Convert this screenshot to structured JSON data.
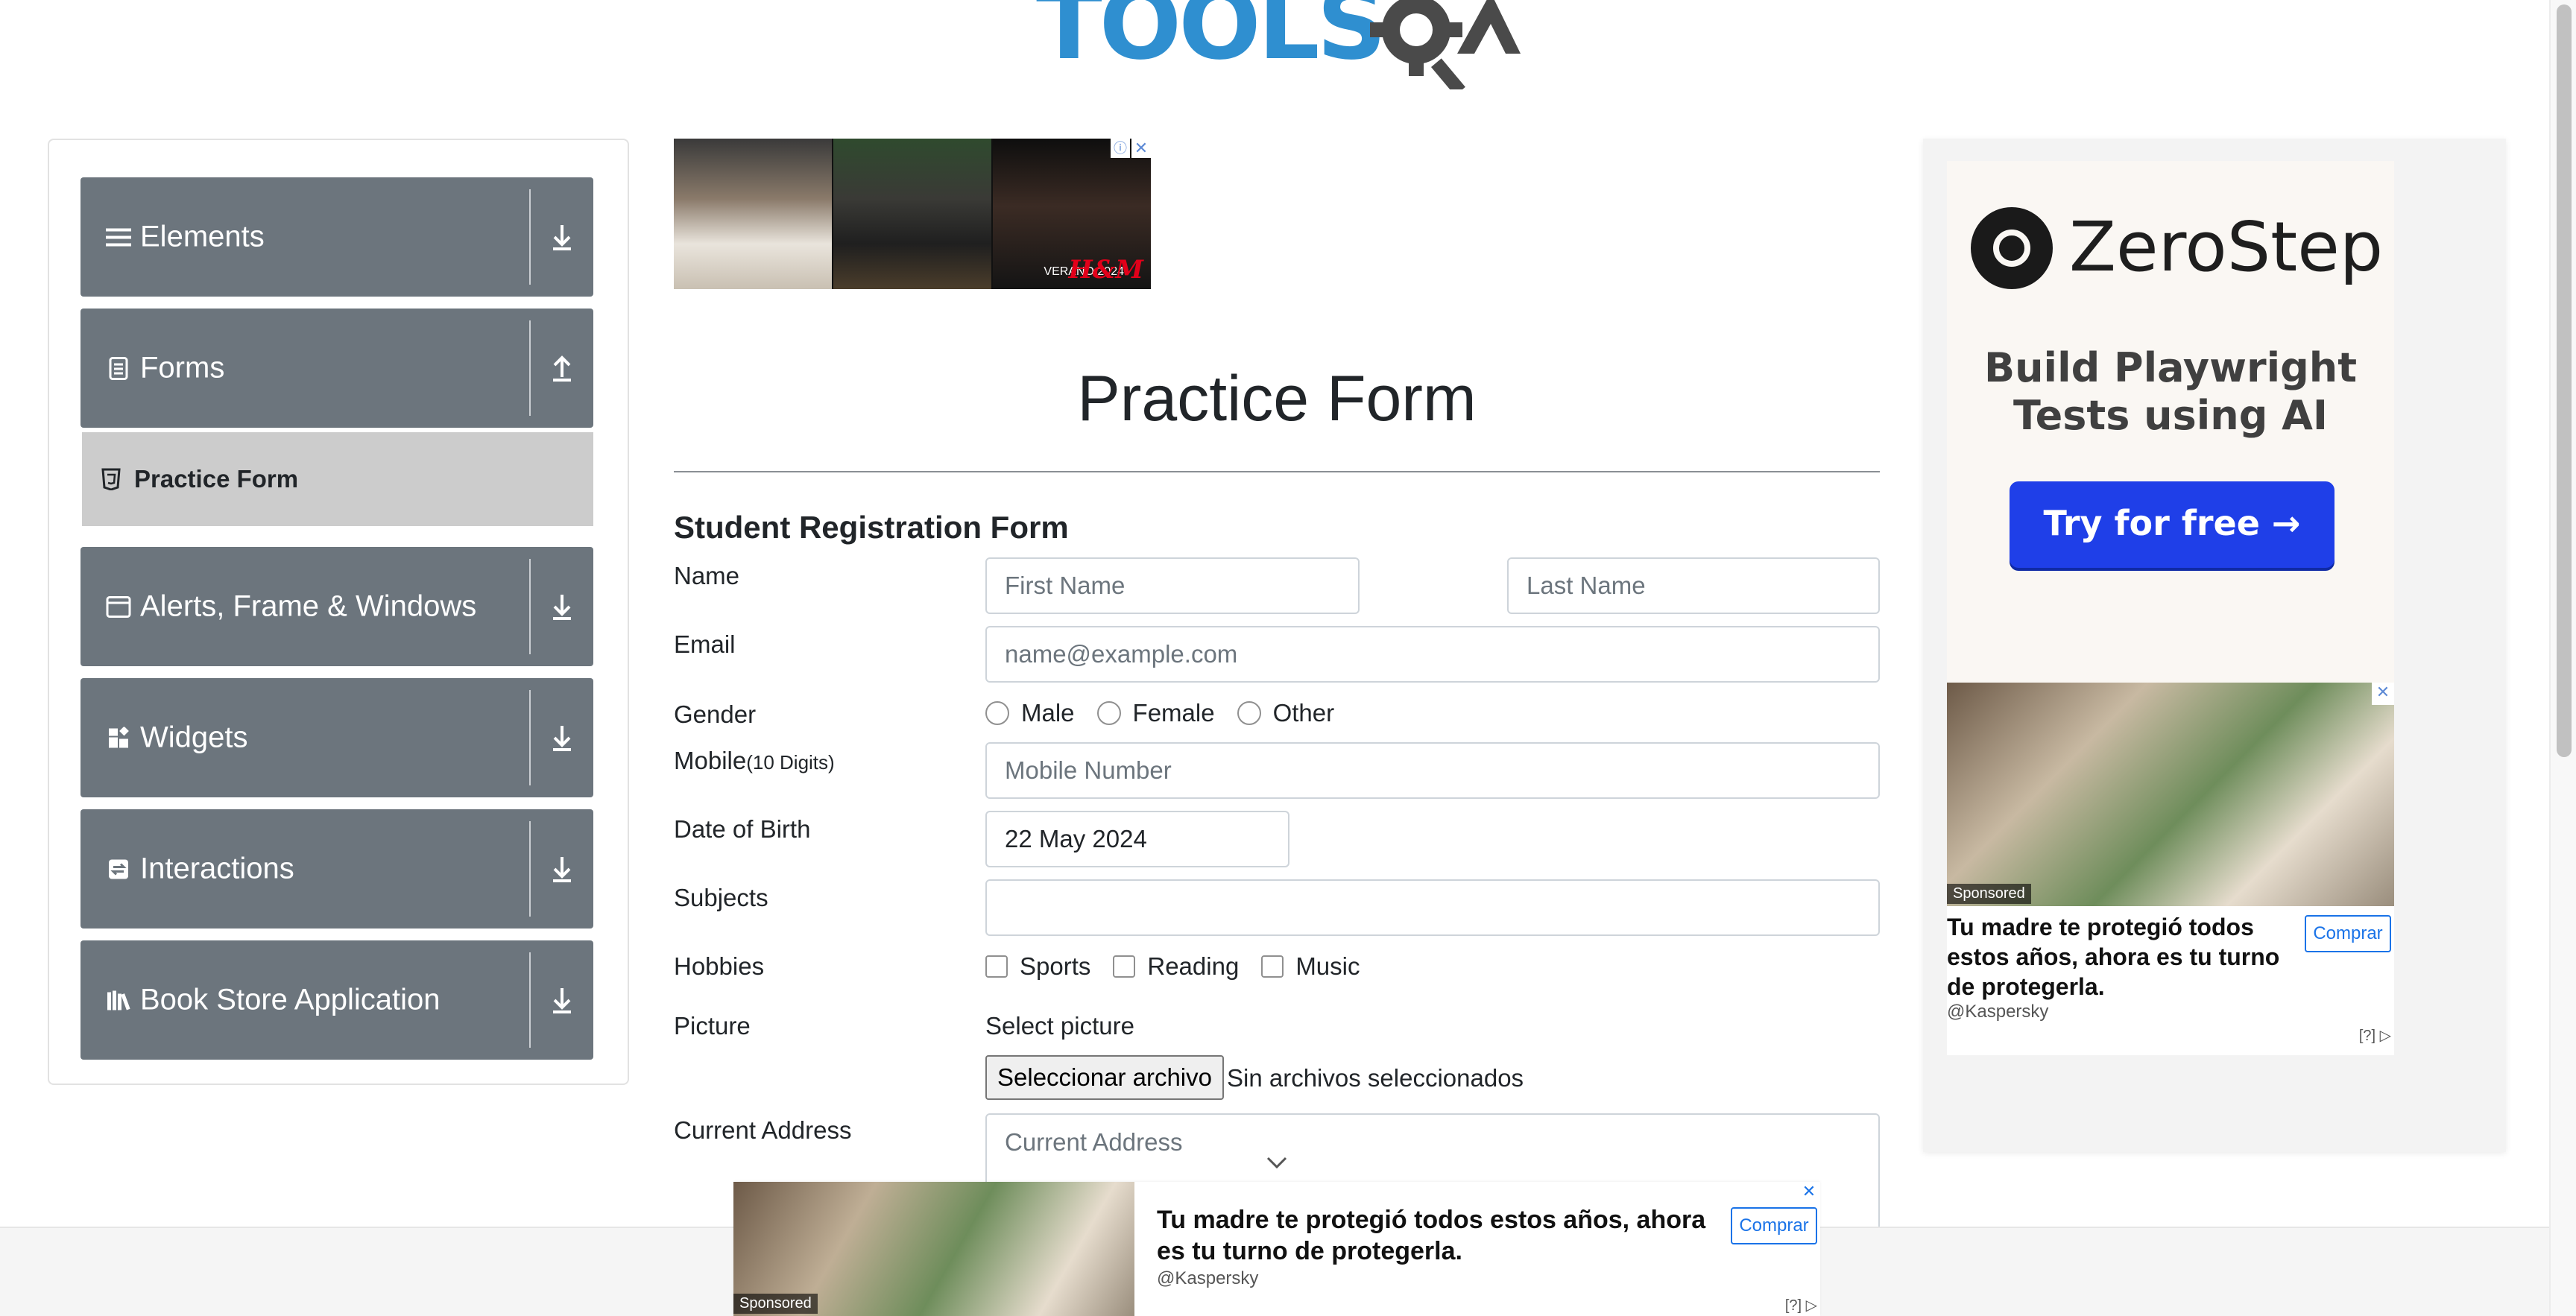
{
  "logo": {
    "text": "TOOLSQA"
  },
  "sidebar": {
    "groups": [
      {
        "label": "Elements",
        "icon": "hamburger-icon",
        "arrow": "download-icon"
      },
      {
        "label": "Forms",
        "icon": "document-icon",
        "arrow": "upload-icon"
      },
      {
        "label": "Alerts, Frame & Windows",
        "icon": "window-icon",
        "arrow": "download-icon"
      },
      {
        "label": "Widgets",
        "icon": "widgets-icon",
        "arrow": "download-icon"
      },
      {
        "label": "Interactions",
        "icon": "interactions-icon",
        "arrow": "download-icon"
      },
      {
        "label": "Book Store Application",
        "icon": "books-icon",
        "arrow": "download-icon"
      }
    ],
    "active_item": {
      "label": "Practice Form",
      "icon": "html5-icon"
    }
  },
  "top_ad": {
    "tag": "VERANO 2024",
    "brand": "H&M"
  },
  "main": {
    "title": "Practice Form",
    "form_title": "Student Registration Form",
    "name": {
      "label": "Name",
      "first_placeholder": "First Name",
      "last_placeholder": "Last Name"
    },
    "email": {
      "label": "Email",
      "placeholder": "name@example.com"
    },
    "gender": {
      "label": "Gender",
      "options": [
        "Male",
        "Female",
        "Other"
      ]
    },
    "mobile": {
      "label": "Mobile",
      "label_suffix": "(10 Digits)",
      "placeholder": "Mobile Number"
    },
    "dob": {
      "label": "Date of Birth",
      "value": "22 May 2024"
    },
    "subjects": {
      "label": "Subjects",
      "value": ""
    },
    "hobbies": {
      "label": "Hobbies",
      "options": [
        "Sports",
        "Reading",
        "Music"
      ]
    },
    "picture": {
      "label": "Picture",
      "select_text": "Select picture",
      "button": "Seleccionar archivo",
      "status": "Sin archivos seleccionados"
    },
    "address": {
      "label": "Current Address",
      "placeholder": "Current Address"
    }
  },
  "right_ad": {
    "brand": "ZeroStep",
    "tagline": "Build Playwright Tests using AI",
    "cta": "Try for free →",
    "sponsored": "Sponsored",
    "text": "Tu madre te protegió todos estos años, ahora es tu turno de protegerla.",
    "handle": "@Kaspersky",
    "buy": "Comprar",
    "q": "[?]"
  },
  "bottom_ad": {
    "sponsored": "Sponsored",
    "text": "Tu madre te protegió todos estos años, ahora es tu turno de protegerla.",
    "handle": "@Kaspersky",
    "buy": "Comprar",
    "q": "[?]"
  },
  "colors": {
    "sidebar_group": "#6c757d",
    "active_item": "#cccccc",
    "accent": "#1f3fe8",
    "logo_blue": "#2f8fd0"
  }
}
